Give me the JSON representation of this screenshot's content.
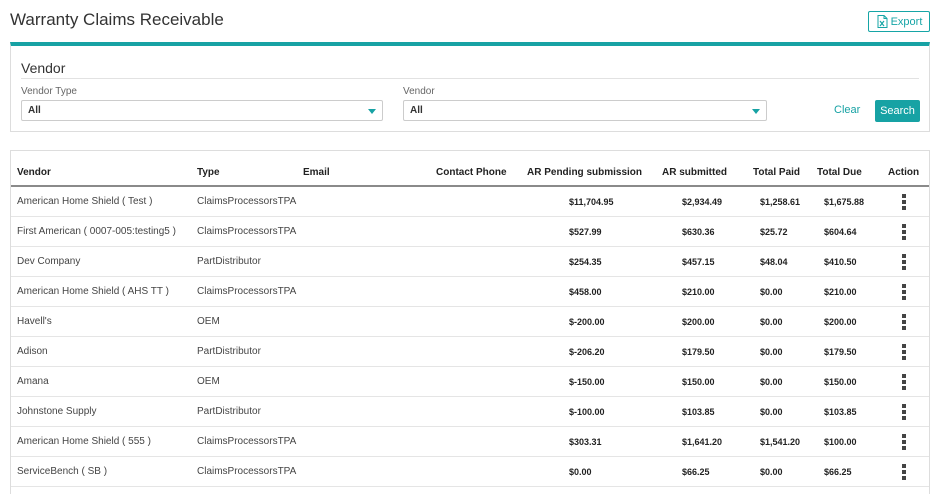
{
  "page": {
    "title": "Warranty Claims Receivable",
    "export_label": "Export"
  },
  "filter": {
    "title": "Vendor",
    "vendor_type_label": "Vendor Type",
    "vendor_type_value": "All",
    "vendor_label": "Vendor",
    "vendor_value": "All",
    "clear_label": "Clear",
    "search_label": "Search"
  },
  "table": {
    "headers": {
      "vendor": "Vendor",
      "type": "Type",
      "email": "Email",
      "phone": "Contact Phone",
      "pending": "AR Pending submission",
      "submitted": "AR submitted",
      "paid": "Total Paid",
      "due": "Total Due",
      "action": "Action"
    },
    "rows": [
      {
        "vendor": "American Home Shield ( Test )",
        "type": "ClaimsProcessorsTPA",
        "email": "",
        "phone": "",
        "pending": "$11,704.95",
        "submitted": "$2,934.49",
        "paid": "$1,258.61",
        "due": "$1,675.88"
      },
      {
        "vendor": "First American ( 0007-005:testing5 )",
        "type": "ClaimsProcessorsTPA",
        "email": "",
        "phone": "",
        "pending": "$527.99",
        "submitted": "$630.36",
        "paid": "$25.72",
        "due": "$604.64"
      },
      {
        "vendor": "Dev Company",
        "type": "PartDistributor",
        "email": "",
        "phone": "",
        "pending": "$254.35",
        "submitted": "$457.15",
        "paid": "$48.04",
        "due": "$410.50"
      },
      {
        "vendor": "American Home Shield ( AHS TT )",
        "type": "ClaimsProcessorsTPA",
        "email": "",
        "phone": "",
        "pending": "$458.00",
        "submitted": "$210.00",
        "paid": "$0.00",
        "due": "$210.00"
      },
      {
        "vendor": "Havell's",
        "type": "OEM",
        "email": "",
        "phone": "",
        "pending": "$-200.00",
        "submitted": "$200.00",
        "paid": "$0.00",
        "due": "$200.00"
      },
      {
        "vendor": "Adison",
        "type": "PartDistributor",
        "email": "",
        "phone": "",
        "pending": "$-206.20",
        "submitted": "$179.50",
        "paid": "$0.00",
        "due": "$179.50"
      },
      {
        "vendor": "Amana",
        "type": "OEM",
        "email": "",
        "phone": "",
        "pending": "$-150.00",
        "submitted": "$150.00",
        "paid": "$0.00",
        "due": "$150.00"
      },
      {
        "vendor": "Johnstone Supply",
        "type": "PartDistributor",
        "email": "",
        "phone": "",
        "pending": "$-100.00",
        "submitted": "$103.85",
        "paid": "$0.00",
        "due": "$103.85"
      },
      {
        "vendor": "American Home Shield ( 555 )",
        "type": "ClaimsProcessorsTPA",
        "email": "",
        "phone": "",
        "pending": "$303.31",
        "submitted": "$1,641.20",
        "paid": "$1,541.20",
        "due": "$100.00"
      },
      {
        "vendor": "ServiceBench ( SB )",
        "type": "ClaimsProcessorsTPA",
        "email": "",
        "phone": "",
        "pending": "$0.00",
        "submitted": "$66.25",
        "paid": "$0.00",
        "due": "$66.25"
      }
    ]
  },
  "icons": {
    "export": "excel-file-icon",
    "select": "caret-down-icon",
    "action": "kebab-menu-icon"
  },
  "colors": {
    "accent": "#17a2a4"
  }
}
